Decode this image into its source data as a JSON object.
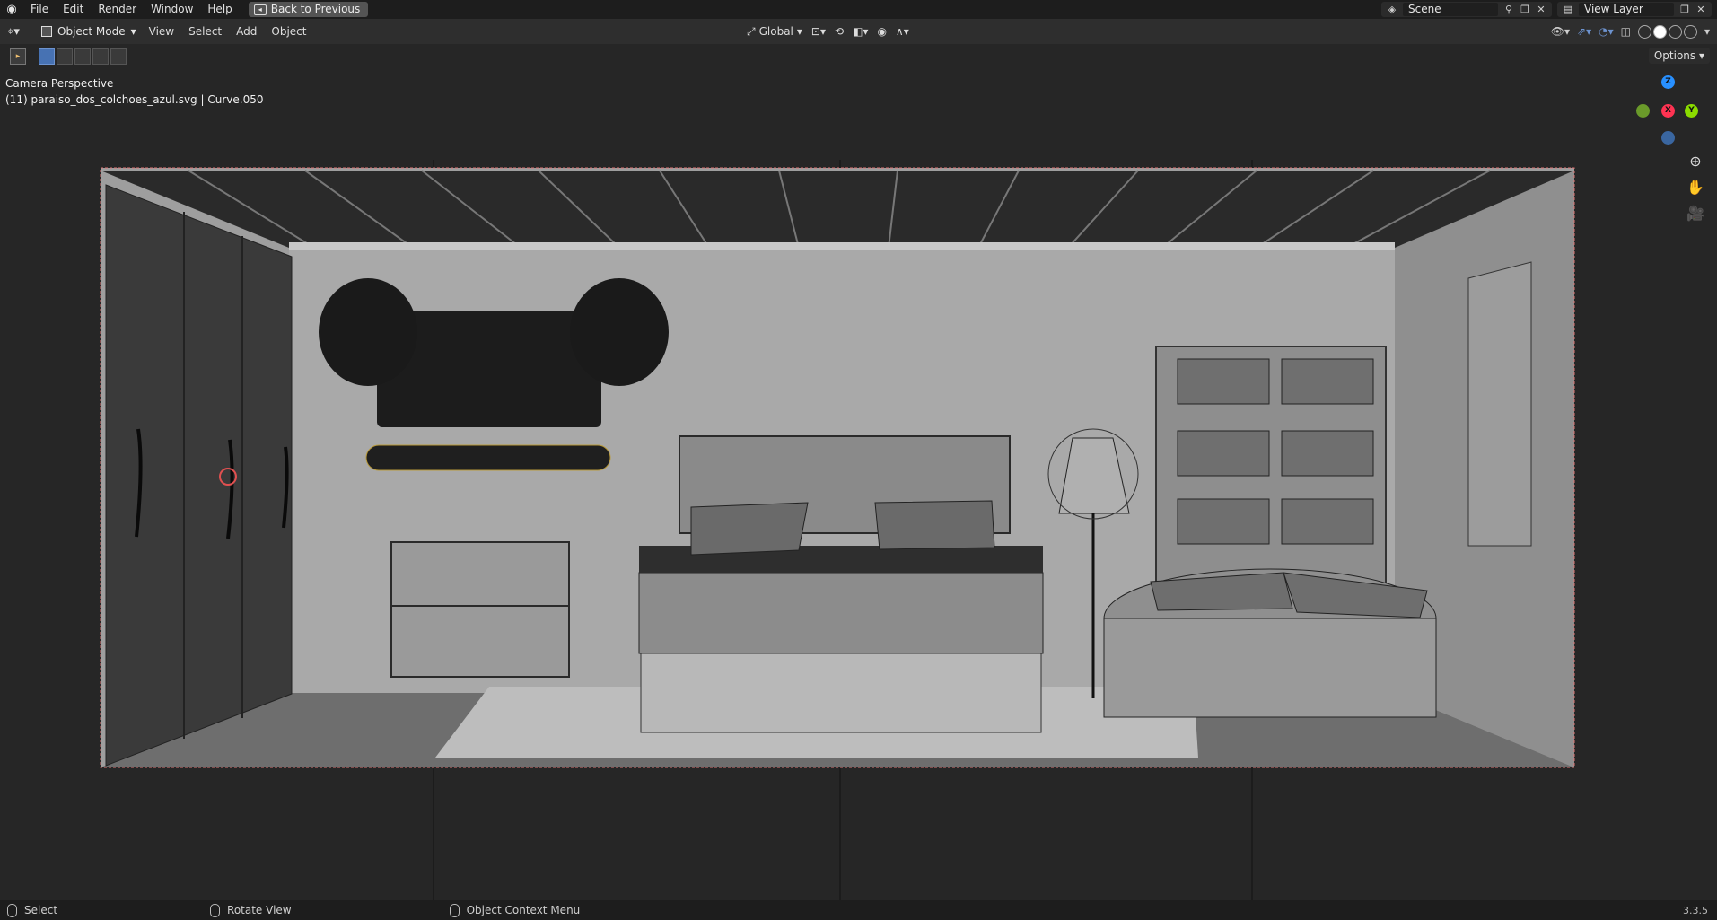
{
  "topbar": {
    "menus": [
      "File",
      "Edit",
      "Render",
      "Window",
      "Help"
    ],
    "back_button": "Back to Previous",
    "scene": "Scene",
    "view_layer": "View Layer"
  },
  "header": {
    "mode": "Object Mode",
    "menus": [
      "View",
      "Select",
      "Add",
      "Object"
    ],
    "transform_orientation": "Global",
    "options_label": "Options"
  },
  "viewport": {
    "view_name": "Camera Perspective",
    "object_info": "(11) paraiso_dos_colchoes_azul.svg | Curve.050",
    "axis_labels": {
      "z": "Z",
      "x": "X",
      "y": "Y"
    }
  },
  "statusbar": {
    "select": "Select",
    "rotate": "Rotate View",
    "context_menu": "Object Context Menu",
    "version": "3.3.5"
  },
  "colors": {
    "axis_x": "#ff3352",
    "axis_y": "#8bdc00",
    "axis_z": "#2890ff",
    "accent": "#4772b3"
  }
}
